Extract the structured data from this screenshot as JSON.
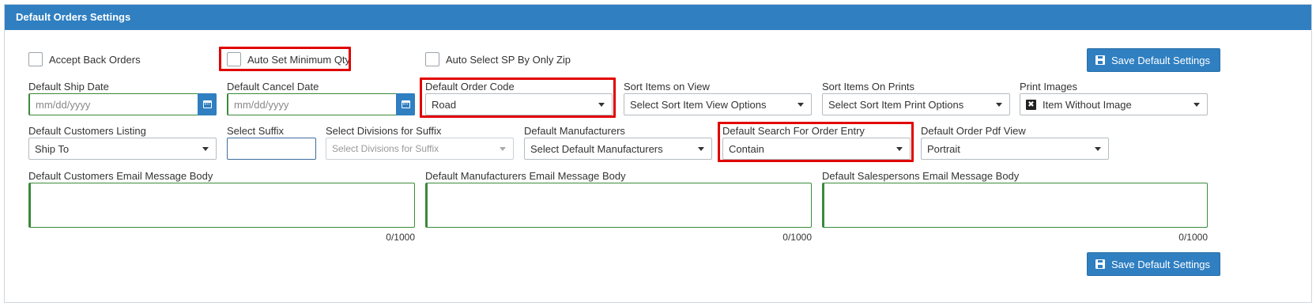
{
  "panel": {
    "title": "Default Orders Settings"
  },
  "checkboxes": {
    "accept_back_orders": "Accept Back Orders",
    "auto_set_min_qty": "Auto Set Minimum Qty",
    "auto_select_sp": "Auto Select SP By Only Zip"
  },
  "buttons": {
    "save_top": "Save Default Settings",
    "save_bottom": "Save Default Settings"
  },
  "row1": {
    "ship_date": {
      "label": "Default Ship Date",
      "placeholder": "mm/dd/yyyy"
    },
    "cancel_date": {
      "label": "Default Cancel Date",
      "placeholder": "mm/dd/yyyy"
    },
    "order_code": {
      "label": "Default Order Code",
      "value": "Road"
    },
    "sort_view": {
      "label": "Sort Items on View",
      "value": "Select Sort Item View Options"
    },
    "sort_prints": {
      "label": "Sort Items On Prints",
      "value": "Select Sort Item Print Options"
    },
    "print_images": {
      "label": "Print Images",
      "value": "Item Without Image",
      "icon_glyph": "✖"
    }
  },
  "row2": {
    "customers_listing": {
      "label": "Default Customers Listing",
      "value": "Ship To"
    },
    "suffix": {
      "label": "Select Suffix",
      "value": ""
    },
    "divisions": {
      "label": "Select Divisions for Suffix",
      "value": "Select Divisions for Suffix"
    },
    "manufacturers": {
      "label": "Default Manufacturers",
      "value": "Select Default Manufacturers"
    },
    "search_entry": {
      "label": "Default Search For Order Entry",
      "value": "Contain"
    },
    "pdf_view": {
      "label": "Default Order Pdf View",
      "value": "Portrait"
    }
  },
  "row3": {
    "customers_email": {
      "label": "Default Customers Email Message Body",
      "counter": "0/1000"
    },
    "manufacturers_email": {
      "label": "Default Manufacturers Email Message Body",
      "counter": "0/1000"
    },
    "salespersons_email": {
      "label": "Default Salespersons Email Message Body",
      "counter": "0/1000"
    }
  },
  "colors": {
    "header": "#2f7fc1",
    "highlight": "#e10000",
    "focus_border": "#3a8a3a"
  }
}
